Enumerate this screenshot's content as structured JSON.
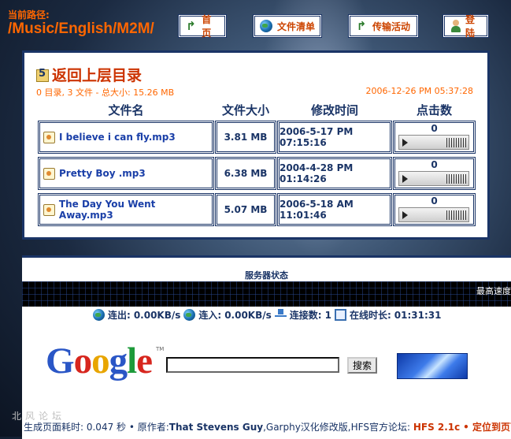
{
  "path": {
    "label": "当前路径:",
    "value": "/Music/English/M2M/"
  },
  "nav": [
    {
      "label": "首页",
      "icon": "arrow-icon"
    },
    {
      "label": "文件清单",
      "icon": "globe-icon"
    },
    {
      "label": "传输活动",
      "icon": "arrow-icon"
    },
    {
      "label": "登陆",
      "icon": "user-icon"
    }
  ],
  "listing": {
    "back_label": "返回上层目录",
    "summary": "0 目录, 3 文件 - 总大小: 15.26 MB",
    "datetime": "2006-12-26 PM 05:37:28",
    "columns": [
      "文件名",
      "文件大小",
      "修改时间",
      "点击数"
    ],
    "files": [
      {
        "name": "I believe i can fly.mp3",
        "size": "3.81 MB",
        "modified": "2006-5-17 PM 07:15:16",
        "hits": "0"
      },
      {
        "name": "Pretty Boy .mp3",
        "size": "6.38 MB",
        "modified": "2004-4-28 PM 01:14:26",
        "hits": "0"
      },
      {
        "name": "The Day You Went Away.mp3",
        "size": "5.07 MB",
        "modified": "2006-5-18 AM 11:01:46",
        "hits": "0"
      }
    ]
  },
  "server": {
    "title": "服务器状态",
    "speed_label": "最高速度",
    "stats": {
      "out_label": "连出:",
      "out_value": "0.00KB/s",
      "in_label": "连入:",
      "in_value": "0.00KB/s",
      "conn_label": "连接数:",
      "conn_value": "1",
      "uptime_label": "在线时长:",
      "uptime_value": "01:31:31"
    }
  },
  "google": {
    "logo": "Google",
    "search_button": "搜索",
    "query": ""
  },
  "footer": {
    "watermark": "北风论坛",
    "text": "生成页面耗时: 0.047 秒 • 原作者:",
    "author": "That Stevens Guy",
    "credits": ",Garphy汉化修改版,HFS官方论坛:",
    "version": "HFS 2.1c",
    "locate": "• 定位到页面顶"
  },
  "colors": {
    "accent": "#ff6600",
    "border": "#1a3466",
    "link": "#1a3fa8"
  }
}
